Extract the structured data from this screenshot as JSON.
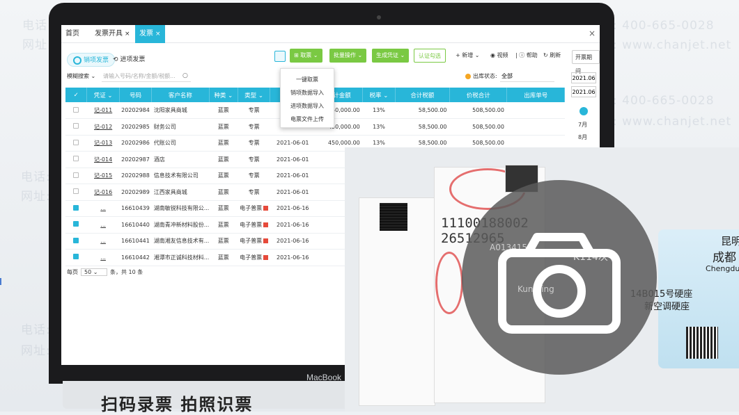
{
  "tabs": [
    {
      "label": "首页"
    },
    {
      "label": "发票开具",
      "close": "×"
    },
    {
      "label": "发票",
      "close": "×"
    }
  ],
  "close_label": "×",
  "subtabs": {
    "sales": "销项发票",
    "purchase": "进项发票"
  },
  "toolbar": {
    "fetch": "取票",
    "batch": "批量操作",
    "voucher": "生成凭证",
    "certify": "认证勾选",
    "add": "+ 新增",
    "video": "视频",
    "help": "帮助",
    "refresh": "刷新",
    "period": "开票期间"
  },
  "filters": {
    "fuzzy": "模糊搜索",
    "placeholder": "请输入号码/名称/金额/税额...",
    "status_label": "出库状态:",
    "status_value": "全部"
  },
  "dropdown": [
    "一键取票",
    "销项数据导入",
    "进项数据导入",
    "电票文件上传"
  ],
  "table": {
    "headers": [
      "",
      "凭证",
      "号码",
      "客户名称",
      "种类",
      "类型",
      "",
      "合计金额",
      "税率",
      "合计税额",
      "价税合计",
      "出库单号"
    ],
    "rows": [
      {
        "voucher": "记-011",
        "no": "20202984",
        "name": "沈阳家具商城",
        "kind": "蓝票",
        "type": "专票",
        "date": "",
        "amount": "450,000.00",
        "rate": "13%",
        "tax": "58,500.00",
        "total": "508,500.00",
        "checked": false
      },
      {
        "voucher": "记-012",
        "no": "20202985",
        "name": "财务公司",
        "kind": "蓝票",
        "type": "专票",
        "date": "",
        "amount": "450,000.00",
        "rate": "13%",
        "tax": "58,500.00",
        "total": "508,500.00",
        "checked": false
      },
      {
        "voucher": "记-013",
        "no": "20202986",
        "name": "代账公司",
        "kind": "蓝票",
        "type": "专票",
        "date": "2021-06-01",
        "amount": "450,000.00",
        "rate": "13%",
        "tax": "58,500.00",
        "total": "508,500.00",
        "checked": false
      },
      {
        "voucher": "记-014",
        "no": "20202987",
        "name": "酒店",
        "kind": "蓝票",
        "type": "专票",
        "date": "2021-06-01",
        "amount": "",
        "rate": "",
        "tax": "",
        "total": "",
        "checked": false
      },
      {
        "voucher": "记-015",
        "no": "20202988",
        "name": "信息技术有限公司",
        "kind": "蓝票",
        "type": "专票",
        "date": "2021-06-01",
        "amount": "",
        "rate": "",
        "tax": "",
        "total": "",
        "checked": false
      },
      {
        "voucher": "记-016",
        "no": "20202989",
        "name": "江西家具商城",
        "kind": "蓝票",
        "type": "专票",
        "date": "2021-06-01",
        "amount": "",
        "rate": "",
        "tax": "",
        "total": "",
        "checked": false
      },
      {
        "voucher": "...",
        "no": "16610439",
        "name": "湖南敏锐科技有限公...",
        "kind": "蓝票",
        "type": "电子普票",
        "date": "2021-06-16",
        "amount": "",
        "rate": "",
        "tax": "",
        "total": "",
        "checked": true
      },
      {
        "voucher": "...",
        "no": "16610440",
        "name": "湖南青冲新材料股份...",
        "kind": "蓝票",
        "type": "电子普票",
        "date": "2021-06-16",
        "amount": "",
        "rate": "",
        "tax": "",
        "total": "",
        "checked": true
      },
      {
        "voucher": "...",
        "no": "16610441",
        "name": "湖南湘友信息技术有...",
        "kind": "蓝票",
        "type": "电子普票",
        "date": "2021-06-16",
        "amount": "",
        "rate": "",
        "tax": "",
        "total": "",
        "checked": true
      },
      {
        "voucher": "...",
        "no": "16610442",
        "name": "湘潭市正诚科技材料...",
        "kind": "蓝票",
        "type": "电子普票",
        "date": "2021-06-16",
        "amount": "",
        "rate": "",
        "tax": "",
        "total": "",
        "checked": true
      }
    ]
  },
  "pager": {
    "label": "每页",
    "size": "50",
    "suffix": "条，共 10 条"
  },
  "right_panel": {
    "date1": "2021.06",
    "date2": "2021.06",
    "months": [
      "7月",
      "8月"
    ]
  },
  "laptop_brand": "MacBook",
  "caption": "扫码录票 拍照识票",
  "watermark": {
    "phone": "电话: 400-665-0028",
    "site": "网址: www.chanjet.net"
  },
  "photo_text": {
    "ticket_from": "昆明",
    "ticket_to": "成都",
    "ticket_en": "Chengdu",
    "train": "K114次",
    "seat": "14B015号硬座",
    "seat2": "新空调硬座",
    "num1": "11100188002",
    "num2": "26512965",
    "kunming": "Kunming",
    "code": "A013415"
  },
  "colors": {
    "accent": "#28b6d9",
    "green": "#7ac943",
    "pdf": "#e64a3b"
  }
}
